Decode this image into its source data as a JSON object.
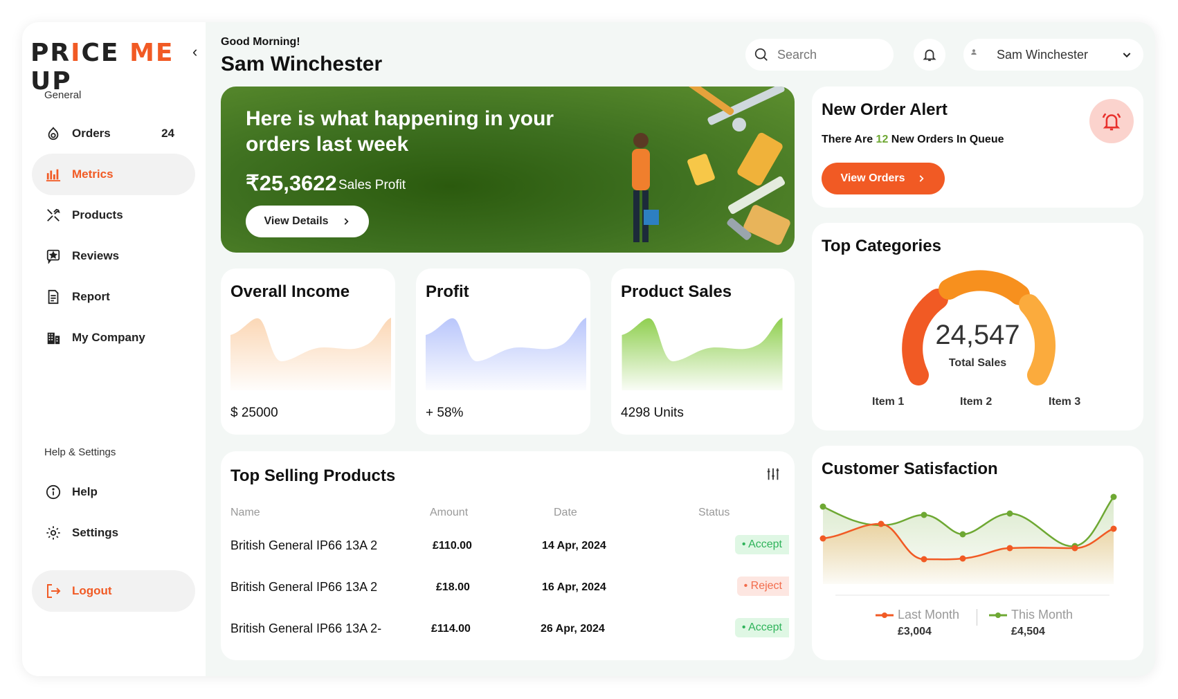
{
  "sidebar": {
    "logo": {
      "p1": "PR",
      "p2": "I",
      "p3": "CE ",
      "p4": "ME",
      "p5": " UP"
    },
    "general_title": "General",
    "items": [
      {
        "label": "Orders",
        "count": "24",
        "icon": "orders-icon"
      },
      {
        "label": "Metrics",
        "icon": "metrics-icon"
      },
      {
        "label": "Products",
        "icon": "tools-icon"
      },
      {
        "label": "Reviews",
        "icon": "reviews-icon"
      },
      {
        "label": "Report",
        "icon": "report-icon"
      },
      {
        "label": "My Company",
        "icon": "company-icon"
      }
    ],
    "help_title": "Help & Settings",
    "help_items": [
      {
        "label": "Help",
        "icon": "info-icon"
      },
      {
        "label": "Settings",
        "icon": "gear-icon"
      }
    ],
    "logout": "Logout"
  },
  "header": {
    "greeting": "Good Morning!",
    "name": "Sam Winchester",
    "search_placeholder": "Search",
    "user_name": "Sam Winchester"
  },
  "hero": {
    "title": "Here is what happening in your orders last week",
    "amount": "₹25,3622",
    "amount_label": "Sales Profit",
    "button": "View Details"
  },
  "stats": [
    {
      "title": "Overall Income",
      "value": "$ 25000",
      "color": "#fbd7b5"
    },
    {
      "title": "Profit",
      "value": "+ 58%",
      "color": "#b9c6fb"
    },
    {
      "title": "Product Sales",
      "value": "4298 Units",
      "color": "#8fcf4f"
    }
  ],
  "alert": {
    "title": "New Order Alert",
    "sub_pre": "There Are ",
    "sub_num": "12",
    "sub_post": " New Orders In Queue",
    "button": "View Orders"
  },
  "categories": {
    "title": "Top Categories",
    "total": "24,547",
    "total_label": "Total Sales",
    "items": [
      "Item 1",
      "Item 2",
      "Item 3"
    ]
  },
  "table": {
    "title": "Top Selling Products",
    "headers": {
      "name": "Name",
      "amount": "Amount",
      "date": "Date",
      "status": "Status"
    },
    "rows": [
      {
        "name": "British General IP66 13A 2",
        "amount": "£110.00",
        "date": "14 Apr, 2024",
        "status": "• Accept"
      },
      {
        "name": "British General IP66 13A 2",
        "amount": "£18.00",
        "date": "16 Apr, 2024",
        "status": "• Reject"
      },
      {
        "name": "British General IP66 13A 2-",
        "amount": "£114.00",
        "date": "26 Apr, 2024",
        "status": "• Accept"
      }
    ]
  },
  "satisfaction": {
    "title": "Customer Satisfaction",
    "legend": [
      {
        "label": "Last Month",
        "value": "£3,004",
        "color": "#f15a24"
      },
      {
        "label": "This Month",
        "value": "£4,504",
        "color": "#6ea833"
      }
    ]
  },
  "colors": {
    "accent": "#f15a24",
    "green": "#6ea833"
  }
}
